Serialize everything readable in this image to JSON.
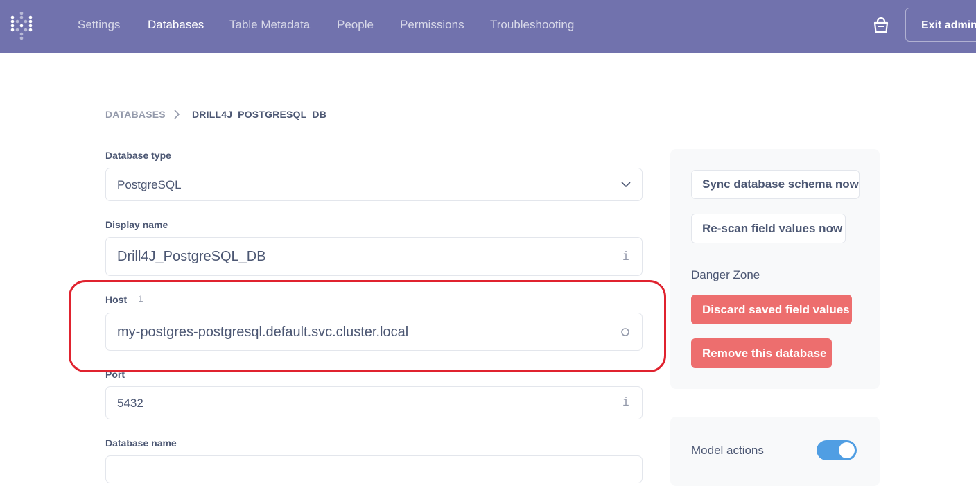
{
  "nav": {
    "items": [
      {
        "label": "Settings"
      },
      {
        "label": "Databases",
        "active": true
      },
      {
        "label": "Table Metadata"
      },
      {
        "label": "People"
      },
      {
        "label": "Permissions"
      },
      {
        "label": "Troubleshooting"
      }
    ],
    "exit_label": "Exit admin",
    "bag_icon": "shopping-bag-icon",
    "logo_icon": "metabase-logo-icon"
  },
  "breadcrumb": {
    "parent": "DATABASES",
    "current": "DRILL4J_POSTGRESQL_DB"
  },
  "form": {
    "database_type": {
      "label": "Database type",
      "value": "PostgreSQL"
    },
    "display_name": {
      "label": "Display name",
      "value": "Drill4J_PostgreSQL_DB"
    },
    "host": {
      "label": "Host",
      "value": "my-postgres-postgresql.default.svc.cluster.local"
    },
    "port": {
      "label": "Port",
      "value": "5432"
    },
    "database_name": {
      "label": "Database name",
      "value": ""
    },
    "info_glyph": "i"
  },
  "actions": {
    "sync_label": "Sync database schema now",
    "rescan_label": "Re-scan field values now",
    "danger_zone_title": "Danger Zone",
    "discard_label": "Discard saved field values",
    "remove_label": "Remove this database"
  },
  "model_actions": {
    "label": "Model actions",
    "enabled": true
  },
  "colors": {
    "nav_bg": "#7172ad",
    "danger": "#ed6e6e",
    "toggle_on": "#509ee3",
    "annotation": "#e0232f"
  }
}
